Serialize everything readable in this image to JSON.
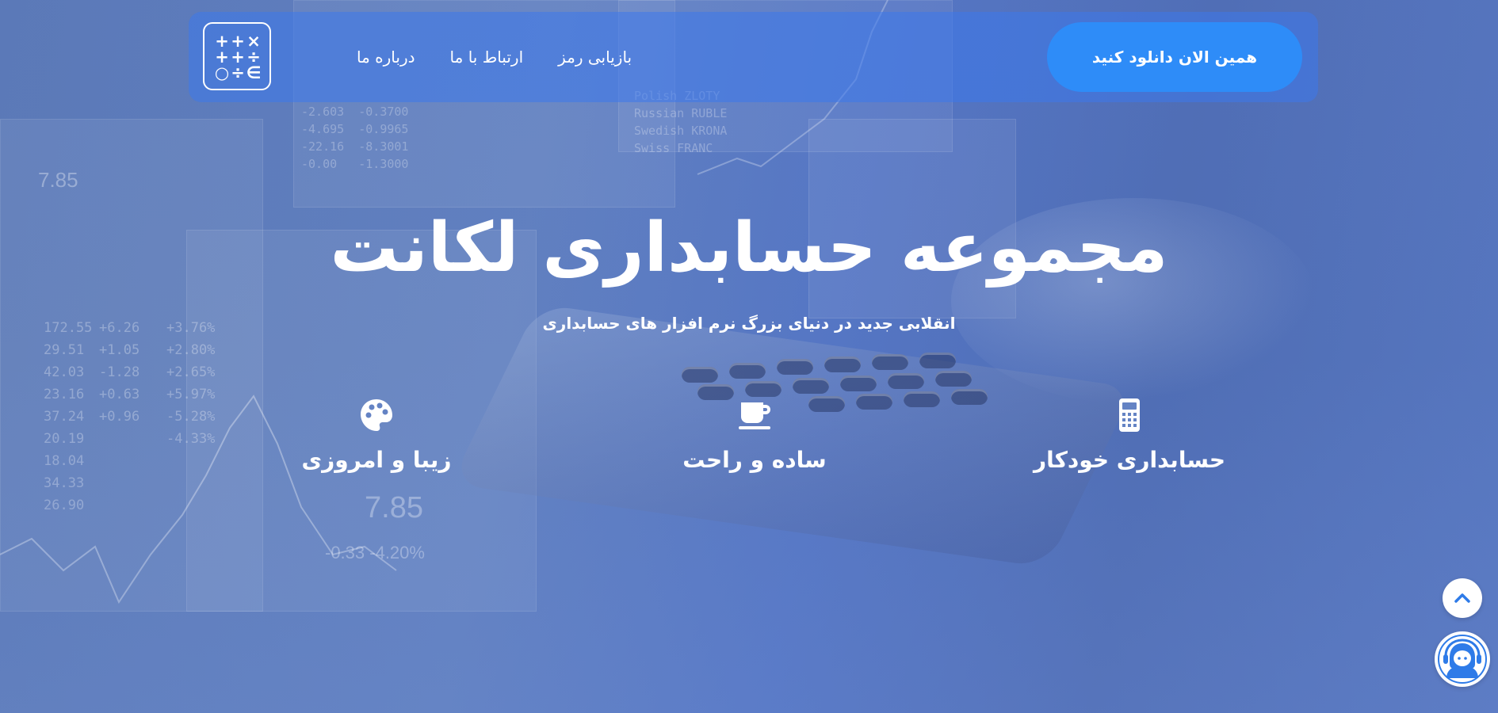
{
  "navbar": {
    "logo_symbols": [
      "+",
      "+",
      "×",
      "+",
      "+",
      "÷",
      "○",
      "÷",
      "∈"
    ],
    "links": [
      {
        "label": "بازیابی رمز"
      },
      {
        "label": "ارتباط با ما"
      },
      {
        "label": "درباره ما"
      }
    ],
    "download_label": "همین الان دانلود کنید"
  },
  "hero": {
    "title": "مجموعه حسابداری لکانت",
    "subtitle": "انقلابی جدید در دنیای بزرگ نرم افزار های حسابداری"
  },
  "features": [
    {
      "label": "حسابداری خودکار",
      "icon": "calculator-icon"
    },
    {
      "label": "ساده و راحت",
      "icon": "coffee-cup-icon"
    },
    {
      "label": "زیبا و امروزی",
      "icon": "palette-icon"
    }
  ],
  "floating": {
    "scroll_top_icon": "chevron-up-icon",
    "support_icon": "support-agent-icon"
  },
  "colors": {
    "background": "#5b79b6",
    "navbar": "#3c78eb",
    "download_button": "#2e8cf8",
    "accent_icon": "#2e7be8",
    "text": "#ffffff"
  }
}
